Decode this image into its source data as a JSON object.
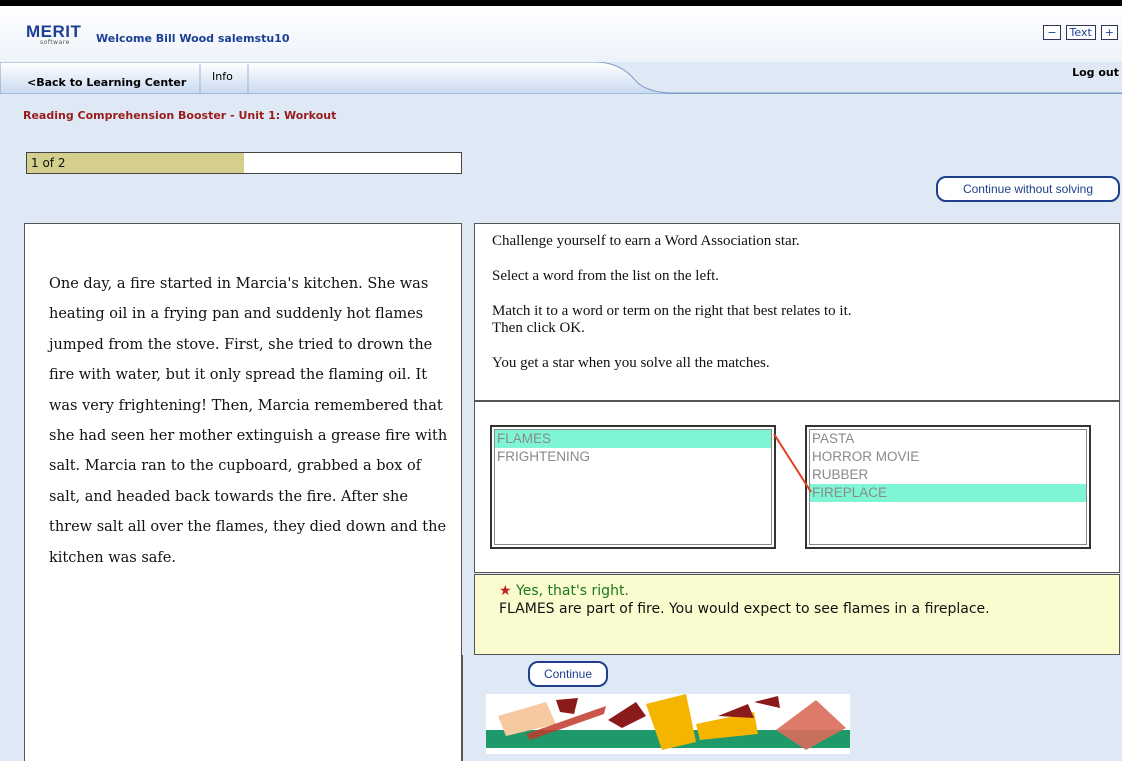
{
  "header": {
    "logo_text": "MERIT",
    "logo_sub": "software",
    "welcome": "Welcome Bill Wood salemstu10",
    "text_controls": {
      "minus": "−",
      "label": "Text",
      "plus": "+"
    }
  },
  "nav": {
    "back": "<Back to Learning Center",
    "info": "Info",
    "logout": "Log out"
  },
  "breadcrumb": "Reading Comprehension Booster - Unit 1: Workout",
  "progress": {
    "label": "1 of 2",
    "fraction": 0.5
  },
  "buttons": {
    "continue_without": "Continue without solving",
    "continue": "Continue"
  },
  "passage": "One day, a fire started in Marcia's kitchen. She was heating oil in a frying pan and suddenly hot flames jumped from the stove. First, she tried to drown the fire with water, but it only spread the flaming oil. It was very frightening! Then, Marcia remembered that she had seen her mother extinguish a grease fire with salt. Marcia ran to the cupboard, grabbed a box of salt, and headed back towards the fire. After she threw salt all over the flames, they died down and the kitchen was safe.",
  "instructions": {
    "line1": "Challenge yourself to earn a Word Association star.",
    "line2": "Select a word from the list on the left.",
    "line3a": "Match it to a word or term on the right that best relates to it.",
    "line3b": "Then click OK.",
    "line4": "You get a star when you solve all the matches."
  },
  "left_list": [
    "FLAMES",
    "FRIGHTENING"
  ],
  "right_list": [
    "PASTA",
    "HORROR MOVIE",
    "RUBBER",
    "FIREPLACE"
  ],
  "selected": {
    "left": "FLAMES",
    "right": "FIREPLACE"
  },
  "feedback": {
    "star": "★",
    "title": "Yes, that's right.",
    "body": "FLAMES are part of fire. You would expect to see flames in a fireplace."
  },
  "colors": {
    "brand_blue": "#1b3f93",
    "breadcrumb_red": "#9a1b1b",
    "selection": "#7ef5d4",
    "feedback_bg": "#fbfbd0",
    "progress_fill": "#d4cf8c",
    "success_green": "#1a7a1a"
  }
}
